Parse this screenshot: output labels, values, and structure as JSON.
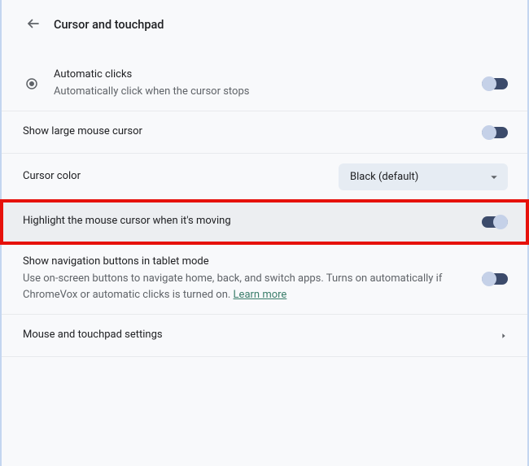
{
  "header": {
    "title": "Cursor and touchpad"
  },
  "rows": {
    "auto_click": {
      "label": "Automatic clicks",
      "sub": "Automatically click when the cursor stops",
      "on": false
    },
    "large_cursor": {
      "label": "Show large mouse cursor",
      "on": false
    },
    "cursor_color": {
      "label": "Cursor color",
      "value": "Black (default)"
    },
    "highlight": {
      "label": "Highlight the mouse cursor when it's moving",
      "on": true
    },
    "nav_buttons": {
      "label": "Show navigation buttons in tablet mode",
      "sub_prefix": "Use on-screen buttons to navigate home, back, and switch apps. Turns on automatically if ChromeVox or automatic clicks is turned on. ",
      "learn_more": "Learn more",
      "on": false
    },
    "mouse_settings": {
      "label": "Mouse and touchpad settings"
    }
  },
  "colors": {
    "toggle_track": "#3c4b6b",
    "highlight_box": "#e6110b"
  }
}
